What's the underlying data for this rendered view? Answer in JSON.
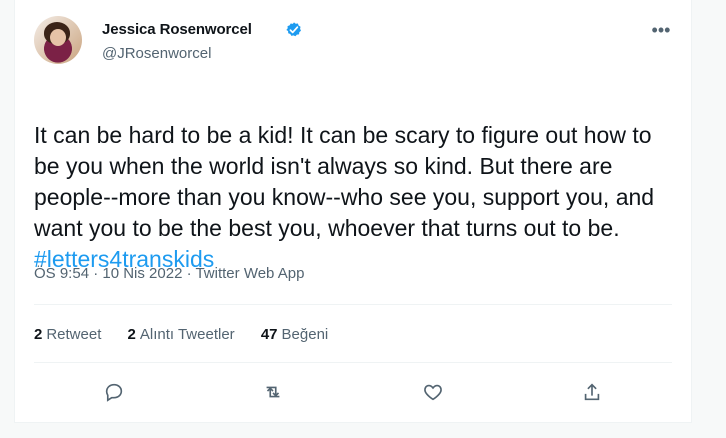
{
  "profile": {
    "name": "Jessica Rosenworcel",
    "handle": "@JRosenworcel",
    "verified_color": "#1d9bf0"
  },
  "tweet": {
    "text": "It can be hard to be a kid! It can be scary to figure out how to be you when the world isn't always so kind. But there are people--more than you know--who see you, support you, and want you to be the best you, whoever that turns out to be. ",
    "hashtag": "#letters4transkids",
    "meta": "ÖS 9:54 · 10 Nis 2022 · Twitter Web App"
  },
  "stats": [
    {
      "count": "2",
      "label": "Retweet"
    },
    {
      "count": "2",
      "label": "Alıntı Tweetler"
    },
    {
      "count": "47",
      "label": "Beğeni"
    }
  ],
  "actions": {
    "reply_icon": "reply-icon",
    "retweet_icon": "retweet-icon",
    "like_icon": "heart-icon",
    "share_icon": "share-icon"
  },
  "colors": {
    "accent": "#1d9bf0",
    "text": "#0f1419",
    "muted": "#536471"
  }
}
